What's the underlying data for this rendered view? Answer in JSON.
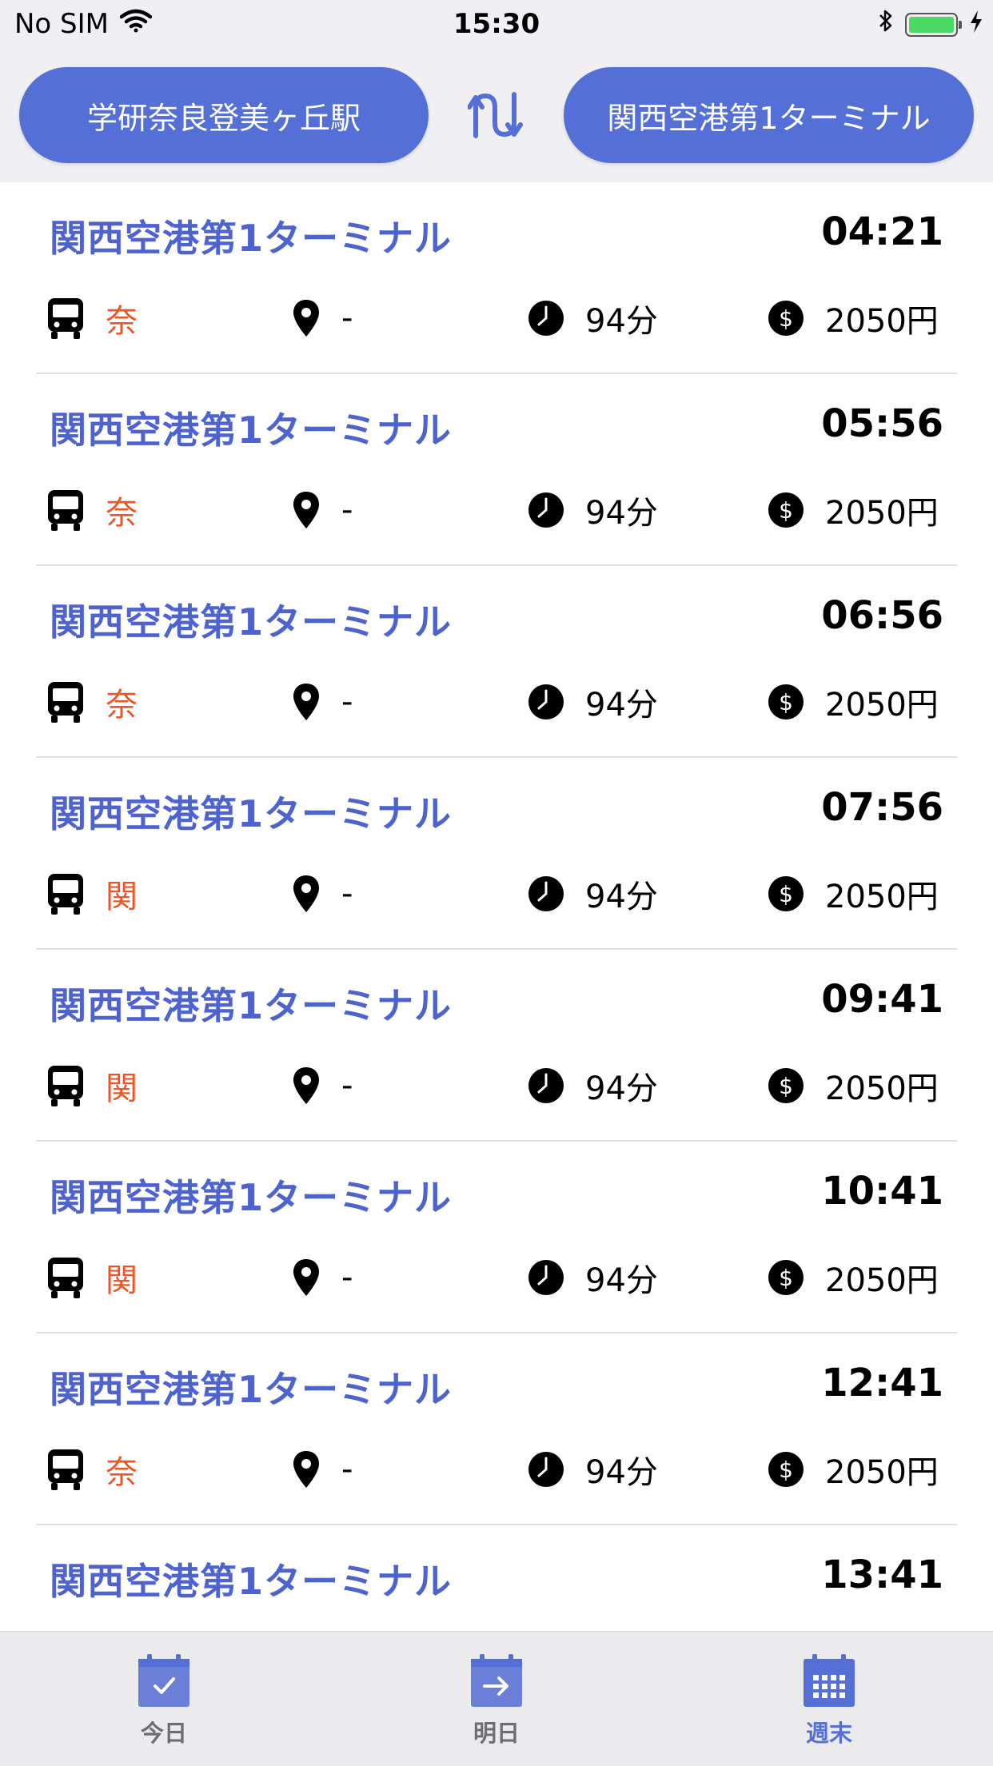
{
  "status_bar": {
    "carrier": "No SIM",
    "time": "15:30"
  },
  "header": {
    "from_station": "学研奈良登美ヶ丘駅",
    "to_station": "関西空港第1ターミナル"
  },
  "icons": {
    "bus": "bus-icon",
    "location": "map-pin-icon",
    "duration": "clock-icon",
    "fare": "dollar-icon"
  },
  "colors": {
    "accent": "#5470d6",
    "title": "#4f63cf",
    "operator": "#e8572a"
  },
  "departures": [
    {
      "destination": "関西空港第1ターミナル",
      "time": "04:21",
      "operator": "奈",
      "stop": "-",
      "duration": "94分",
      "fare": "2050円"
    },
    {
      "destination": "関西空港第1ターミナル",
      "time": "05:56",
      "operator": "奈",
      "stop": "-",
      "duration": "94分",
      "fare": "2050円"
    },
    {
      "destination": "関西空港第1ターミナル",
      "time": "06:56",
      "operator": "奈",
      "stop": "-",
      "duration": "94分",
      "fare": "2050円"
    },
    {
      "destination": "関西空港第1ターミナル",
      "time": "07:56",
      "operator": "関",
      "stop": "-",
      "duration": "94分",
      "fare": "2050円"
    },
    {
      "destination": "関西空港第1ターミナル",
      "time": "09:41",
      "operator": "関",
      "stop": "-",
      "duration": "94分",
      "fare": "2050円"
    },
    {
      "destination": "関西空港第1ターミナル",
      "time": "10:41",
      "operator": "関",
      "stop": "-",
      "duration": "94分",
      "fare": "2050円"
    },
    {
      "destination": "関西空港第1ターミナル",
      "time": "12:41",
      "operator": "奈",
      "stop": "-",
      "duration": "94分",
      "fare": "2050円"
    },
    {
      "destination": "関西空港第1ターミナル",
      "time": "13:41"
    }
  ],
  "tabs": [
    {
      "label": "今日",
      "icon": "calendar-check-icon",
      "active": false
    },
    {
      "label": "明日",
      "icon": "calendar-arrow-icon",
      "active": false
    },
    {
      "label": "週末",
      "icon": "calendar-grid-icon",
      "active": true
    }
  ]
}
